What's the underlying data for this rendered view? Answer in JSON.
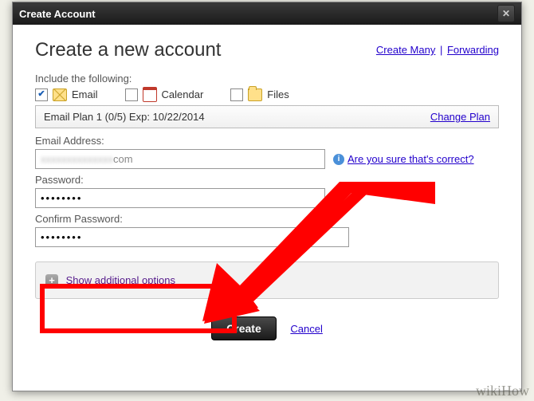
{
  "titlebar": {
    "title": "Create Account"
  },
  "header": {
    "heading": "Create a new account",
    "create_many": "Create Many",
    "forwarding": "Forwarding"
  },
  "include": {
    "label": "Include the following:",
    "email": "Email",
    "calendar": "Calendar",
    "files": "Files"
  },
  "plan": {
    "text": "Email Plan 1 (0/5) Exp: 10/22/2014",
    "change": "Change Plan"
  },
  "email": {
    "label": "Email Address:",
    "value_suffix": "com",
    "hint": "Are you sure that's correct?"
  },
  "password": {
    "label": "Password:",
    "value": "••••••••"
  },
  "confirm": {
    "label": "Confirm Password:",
    "value": "••••••••"
  },
  "options": {
    "show": "Show additional options"
  },
  "buttons": {
    "create": "Create",
    "cancel": "Cancel"
  },
  "watermark": "wikiHow"
}
